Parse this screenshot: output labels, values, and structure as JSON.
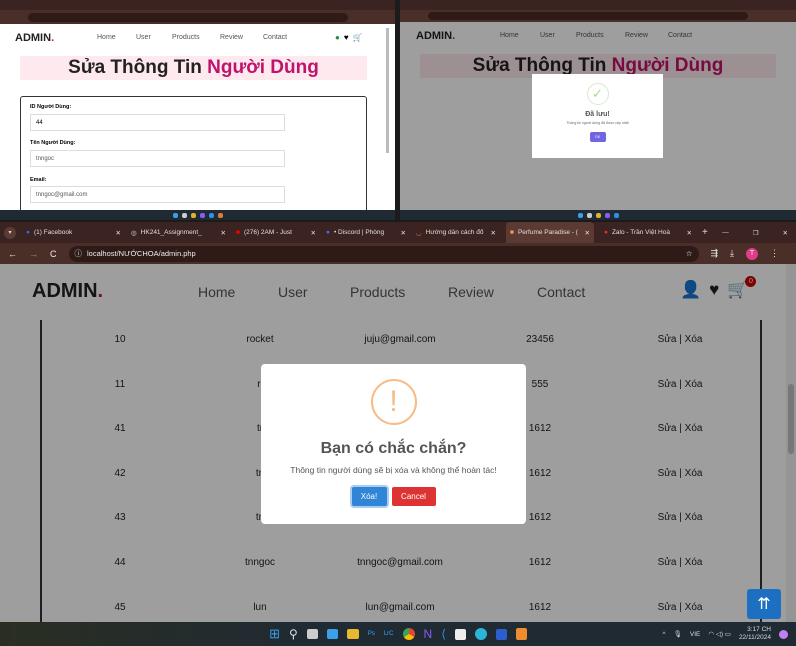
{
  "colors": {
    "brand_accent": "#c0136b",
    "success": "#a5dc86",
    "warning": "#f8bb86",
    "confirm": "#3085d6",
    "cancel": "#dd3333",
    "ok": "#7066e0",
    "scroll_top": "#1c6fc1"
  },
  "header": {
    "logo": "ADMIN",
    "logo_dot": ".",
    "nav": [
      "Home",
      "User",
      "Products",
      "Review",
      "Contact"
    ],
    "cart_count": "0"
  },
  "edit_page": {
    "title_part1": "Sửa Thông Tin",
    "title_part2": "Người Dùng",
    "fields": [
      {
        "label": "ID Người Dùng:",
        "value": "44"
      },
      {
        "label": "Tên Người Dùng:",
        "value": "tnngoc"
      },
      {
        "label": "Email:",
        "value": "tnngoc@gmail.com"
      }
    ]
  },
  "saved_dialog": {
    "title": "Đã lưu!",
    "message": "Thông tin người dùng đã được cập nhật",
    "ok": "OK"
  },
  "browser": {
    "tabs": [
      "(1) Facebook",
      "HK241_Assignment_",
      "(276) 2AM - Just",
      "• Discord | Phòng",
      "Hướng dẫn cách đổ",
      "Perfume Paradise - (",
      "Zalo - Trần Việt Hoà"
    ],
    "url": "localhost/NƯỚCHOA/admin.php",
    "profile": "T"
  },
  "table": {
    "rows": [
      {
        "id": "10",
        "name": "rocket",
        "email": "juju@gmail.com",
        "phone": "23456",
        "actions": "Sửa | Xóa"
      },
      {
        "id": "11",
        "name": "ri",
        "email": "",
        "phone": "555",
        "actions": "Sửa | Xóa"
      },
      {
        "id": "41",
        "name": "tr",
        "email": "",
        "phone": "1612",
        "actions": "Sửa | Xóa"
      },
      {
        "id": "42",
        "name": "tn",
        "email": "",
        "phone": "1612",
        "actions": "Sửa | Xóa"
      },
      {
        "id": "43",
        "name": "tn",
        "email": "",
        "phone": "1612",
        "actions": "Sửa | Xóa"
      },
      {
        "id": "44",
        "name": "tnngoc",
        "email": "tnngoc@gmail.com",
        "phone": "1612",
        "actions": "Sửa | Xóa"
      },
      {
        "id": "45",
        "name": "lun",
        "email": "lun@gmail.com",
        "phone": "1612",
        "actions": "Sửa | Xóa"
      }
    ]
  },
  "confirm_dialog": {
    "icon": "!",
    "title": "Bạn có chắc chắn?",
    "message": "Thông tin người dùng sẽ bị xóa và không thể hoàn tác!",
    "confirm": "Xóa!",
    "cancel": "Cancel"
  },
  "scroll_top": "⇈",
  "taskbar": {
    "lang": "VIE",
    "time": "3:17 CH",
    "date": "22/11/2024"
  }
}
